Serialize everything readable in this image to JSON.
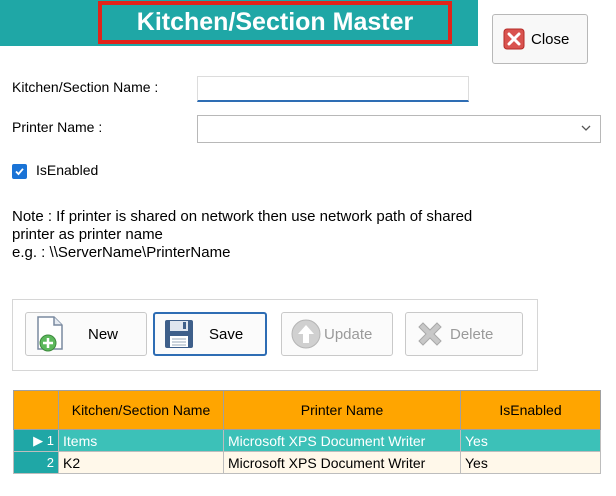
{
  "header": {
    "title": "Kitchen/Section Master",
    "close_label": "Close"
  },
  "form": {
    "kitchen_label": "Kitchen/Section Name :",
    "kitchen_value": "",
    "printer_label": "Printer Name :",
    "printer_value": "",
    "enabled_label": "IsEnabled",
    "enabled_checked": true
  },
  "note": {
    "line1": "Note : If printer is shared on network then use network path of shared",
    "line2": "printer as printer name",
    "line3": "e.g. : \\\\ServerName\\PrinterName"
  },
  "toolbar": {
    "new_label": "New",
    "save_label": "Save",
    "update_label": "Update",
    "delete_label": "Delete"
  },
  "grid": {
    "columns": [
      "Kitchen/Section Name",
      "Printer Name",
      "IsEnabled"
    ],
    "rows": [
      {
        "num": "1",
        "name": "Items",
        "printer": "Microsoft XPS Document Writer",
        "enabled": "Yes"
      },
      {
        "num": "2",
        "name": "K2",
        "printer": "Microsoft XPS Document Writer",
        "enabled": "Yes"
      }
    ]
  },
  "colors": {
    "accent": "#1fa7a6",
    "title_border": "#e2231a",
    "grid_header": "#ffa500"
  }
}
